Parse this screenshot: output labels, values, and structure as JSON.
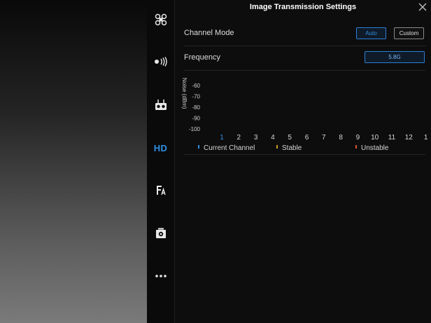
{
  "panel": {
    "title": "Image Transmission Settings"
  },
  "nav": {
    "items": [
      {
        "name": "aircraft-icon",
        "label": ""
      },
      {
        "name": "signal-icon",
        "label": ""
      },
      {
        "name": "remote-controller-icon",
        "label": ""
      },
      {
        "name": "hd-tab",
        "label": "HD"
      },
      {
        "name": "battery-icon",
        "label": ""
      },
      {
        "name": "camera-icon",
        "label": ""
      },
      {
        "name": "more-icon",
        "label": "···"
      }
    ],
    "active": "HD",
    "accent_color": "#2f8fe5"
  },
  "channel_mode": {
    "label": "Channel Mode",
    "options": [
      "Auto",
      "Custom"
    ],
    "selected": "Auto"
  },
  "frequency": {
    "label": "Frequency",
    "value": "5.8G"
  },
  "chart_data": {
    "type": "bar",
    "ylabel": "Noise (dBm)",
    "yticks": [
      "-60",
      "-70",
      "-80",
      "-90",
      "-100"
    ],
    "ylim": [
      -100,
      -55
    ],
    "categories": [
      "1",
      "2",
      "3",
      "4",
      "5",
      "6",
      "7",
      "8",
      "9",
      "10",
      "11",
      "12",
      "1"
    ],
    "highlighted_category_index": 0,
    "legend": [
      {
        "label": "Current Channel",
        "color": "#2f8fe5"
      },
      {
        "label": "Stable",
        "color": "#c8a02a"
      },
      {
        "label": "Unstable",
        "color": "#d9542c"
      }
    ],
    "legend_position": "bottom",
    "grid": false
  }
}
